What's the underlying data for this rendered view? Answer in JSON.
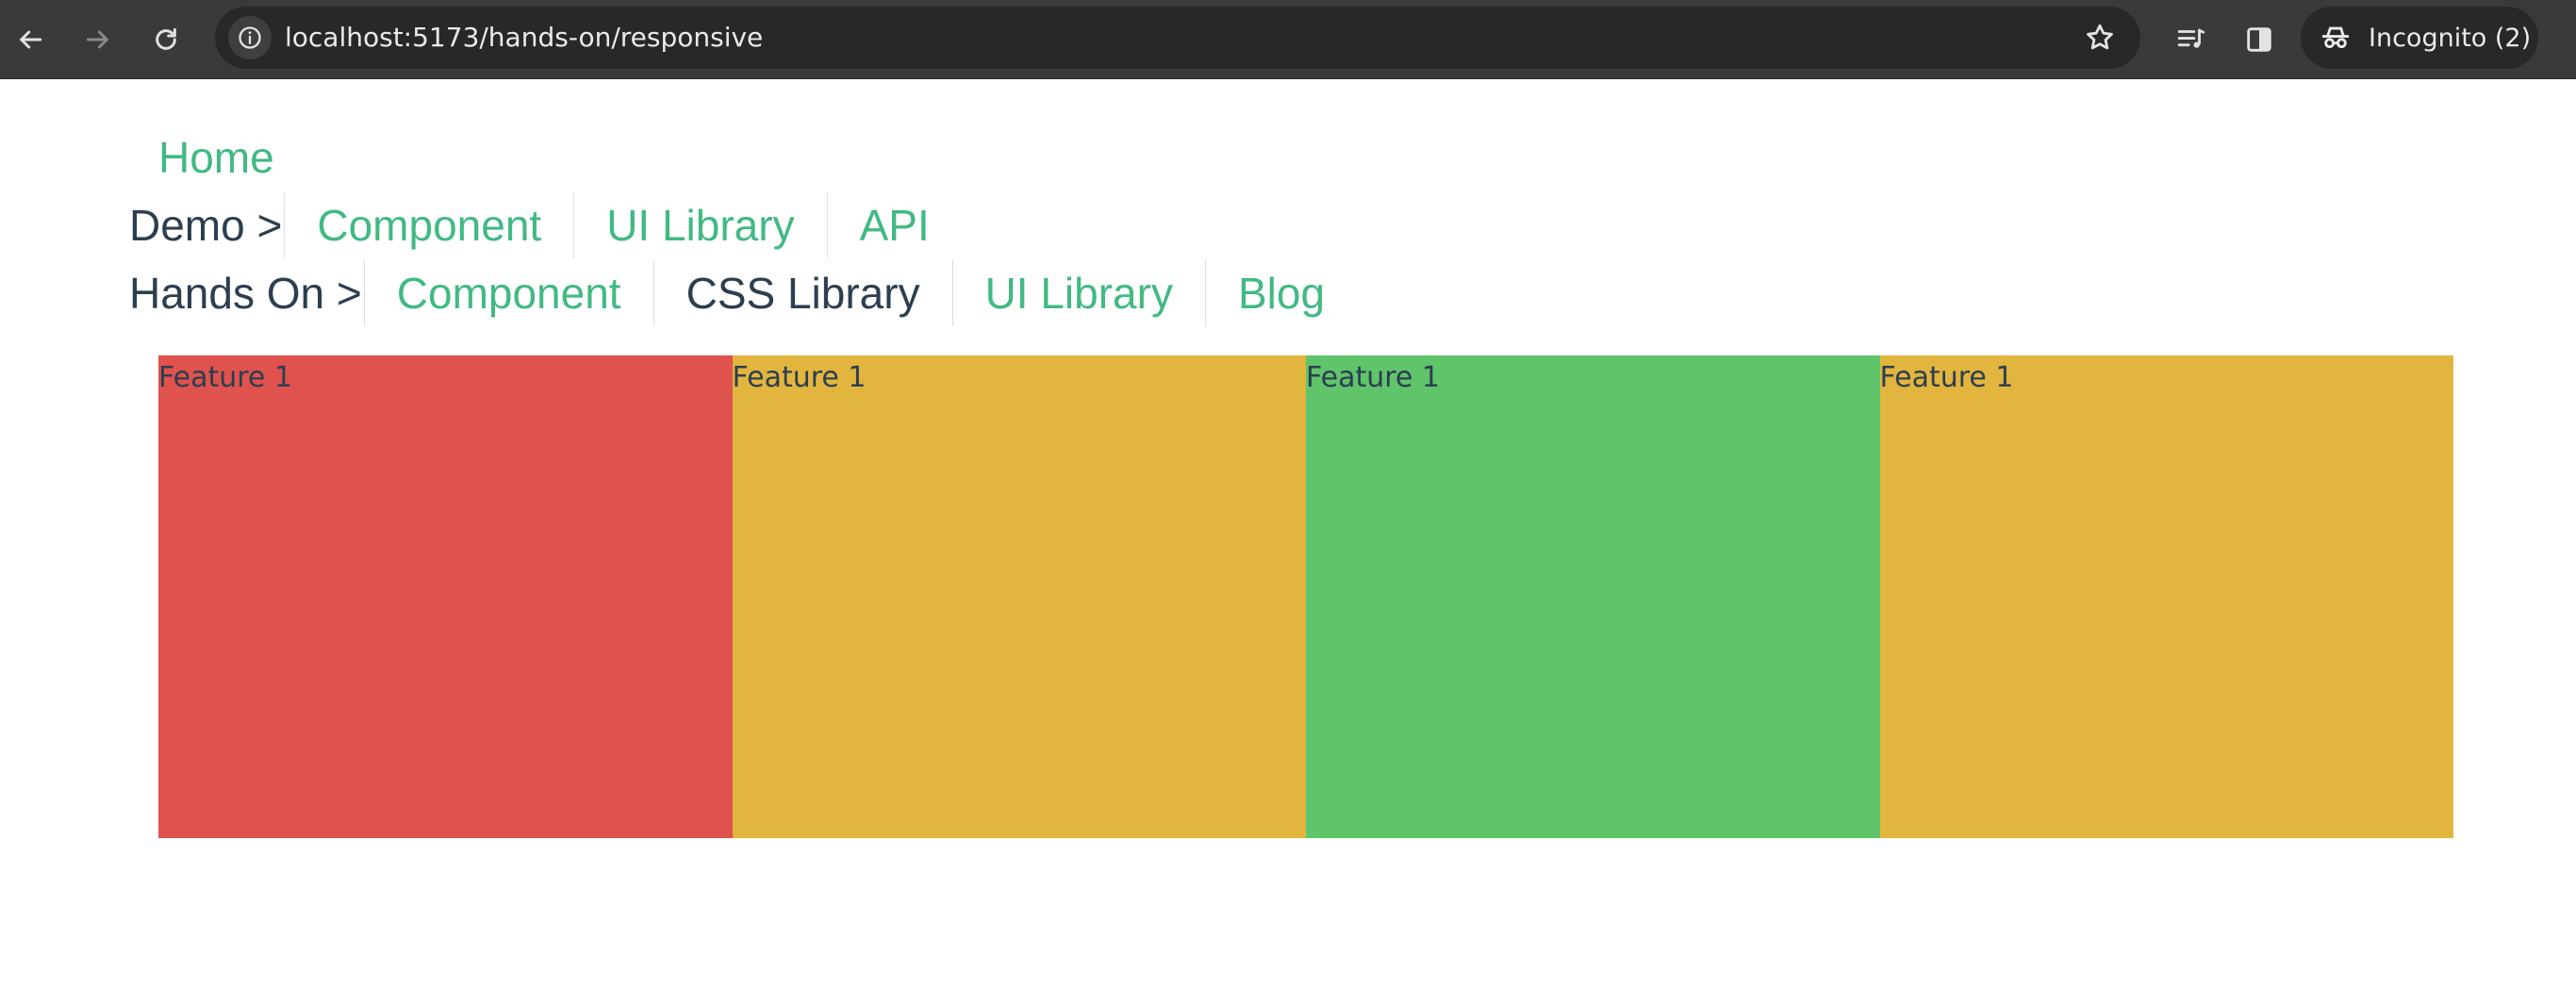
{
  "browser": {
    "url": "localhost:5173/hands-on/responsive",
    "incognito_label": "Incognito (2)",
    "icons": {
      "back": "back-arrow-icon",
      "forward": "forward-arrow-icon",
      "reload": "reload-icon",
      "site_info": "site-info-icon",
      "bookmark": "star-icon",
      "media": "media-queue-icon",
      "side_panel": "side-panel-icon",
      "incognito": "incognito-icon"
    }
  },
  "nav": {
    "home": "Home",
    "demo": {
      "prefix": "Demo >",
      "links": [
        "Component",
        "UI Library",
        "API"
      ]
    },
    "hands_on": {
      "prefix": "Hands On >",
      "links": [
        "Component",
        "CSS Library",
        "UI Library",
        "Blog"
      ],
      "active_index": 1
    }
  },
  "features": [
    {
      "label": "Feature 1",
      "color": "#df524d"
    },
    {
      "label": "Feature 1",
      "color": "#e2b53e"
    },
    {
      "label": "Feature 1",
      "color": "#5fc46a"
    },
    {
      "label": "Feature 1",
      "color": "#e2b53e"
    }
  ],
  "colors": {
    "link": "#42b983",
    "text": "#2c3e50",
    "chrome_bg": "#3a3a3a",
    "omnibox_bg": "#282828"
  }
}
